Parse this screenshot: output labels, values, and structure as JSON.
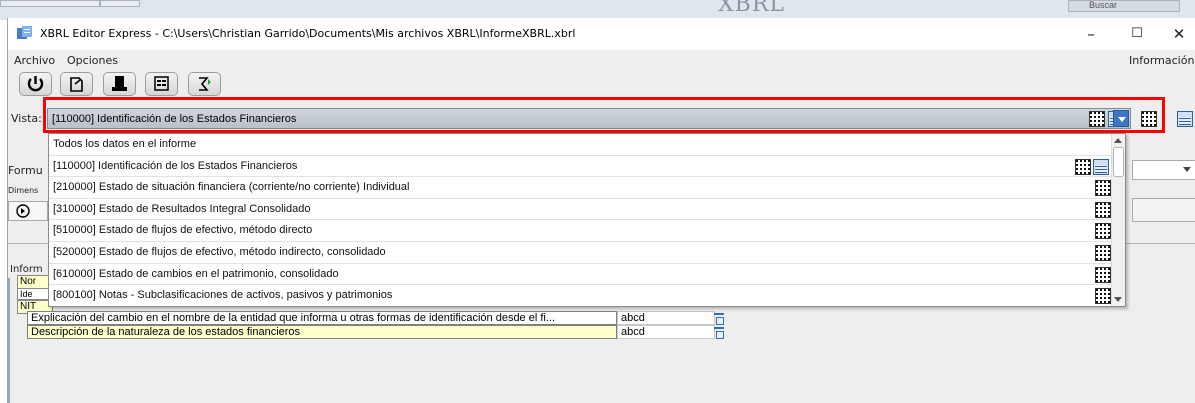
{
  "window": {
    "title": "XBRL Editor Express - C:\\Users\\Christian Garrido\\Documents\\Mis archivos XBRL\\InformeXBRL.xbrl",
    "minimize": "–",
    "maximize": "☐",
    "close": "✕"
  },
  "background": {
    "partial_text": "XBRL",
    "button_label": "Buscar"
  },
  "menu": {
    "archivo": "Archivo",
    "opciones": "Opciones",
    "informacion": "Información"
  },
  "toolbar": {
    "buttons": [
      "power-icon",
      "export-icon",
      "print-icon",
      "form-view-icon",
      "sigma-icon"
    ]
  },
  "vista": {
    "label": "Vista:",
    "selected": "[110000] Identificación de los Estados Financieros",
    "options": [
      "Todos los datos en el informe",
      "[110000] Identificación de los Estados Financieros",
      "[210000] Estado de situación financiera (corriente/no corriente) Individual",
      "[310000] Estado de Resultados Integral Consolidado",
      "[510000] Estado de flujos de efectivo, método directo",
      "[520000] Estado de flujos de efectivo, método indirecto, consolidado",
      "[610000] Estado de cambios en el patrimonio, consolidado",
      "[800100] Notas - Subclasificaciones de activos, pasivos y patrimonios"
    ]
  },
  "side_labels": {
    "formula": "Formu",
    "dimension": "Dimens",
    "informe": "Inform",
    "row1": "Nor",
    "row2": "Ide",
    "row3": "NIT"
  },
  "table": {
    "rows": [
      {
        "label": "Explicación del cambio en el nombre de la entidad que informa u otras formas de identificación desde el fi...",
        "value": "abcd"
      },
      {
        "label": "Descripción de la naturaleza de los estados financieros",
        "value": "abcd"
      }
    ]
  },
  "colors": {
    "highlight": "#ff0000",
    "row_yellow": "#ffffcc",
    "combo_arrow": "#3d76c4"
  }
}
